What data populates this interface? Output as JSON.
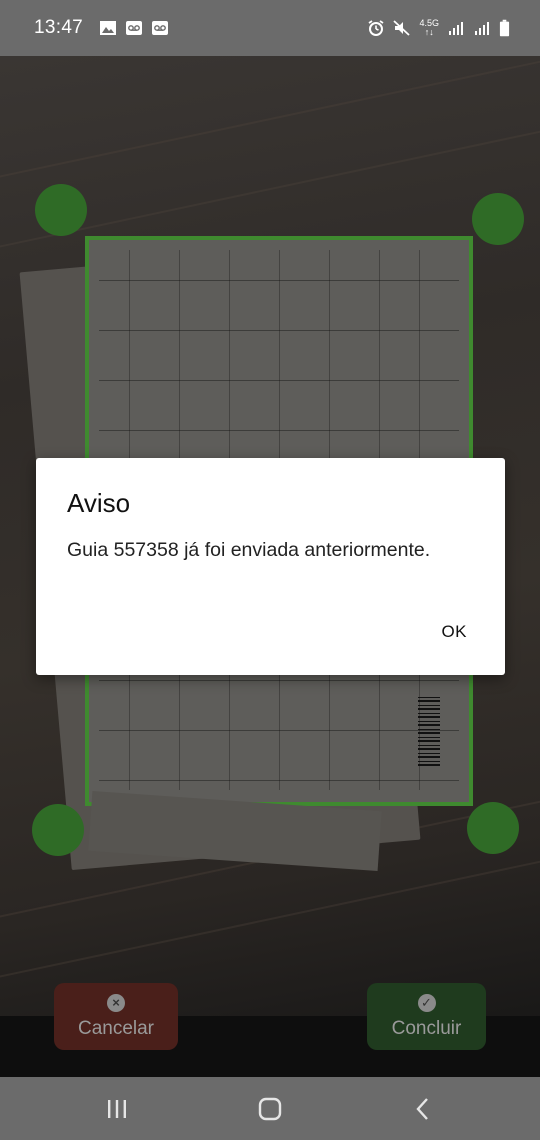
{
  "status_bar": {
    "time": "13:47",
    "left_icons": [
      "image-icon",
      "voicemail-icon",
      "voicemail-icon"
    ],
    "right_icons": [
      "alarm-icon",
      "mute-icon",
      "network-4g-icon",
      "signal-icon",
      "signal-icon",
      "battery-icon"
    ],
    "network_label": "4.5G"
  },
  "dialog": {
    "title": "Aviso",
    "message": "Guia 557358 já foi enviada anteriormente.",
    "ok_label": "OK"
  },
  "actions": {
    "cancel_label": "Cancelar",
    "done_label": "Concluir"
  },
  "nav_bar": {
    "buttons": [
      "recents-icon",
      "home-icon",
      "back-icon"
    ]
  },
  "colors": {
    "crop_frame": "#3f8a2f",
    "handle": "#2f6b26",
    "cancel_bg": "#4a1f1a",
    "done_bg": "#1f3b1e"
  }
}
